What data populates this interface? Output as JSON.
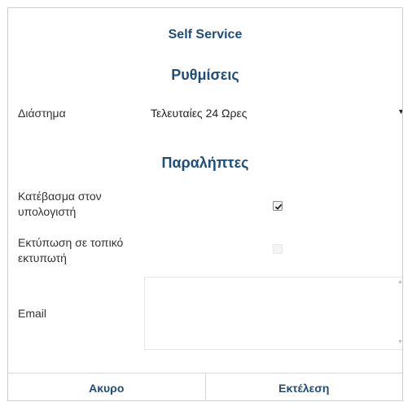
{
  "dialog": {
    "title": "Self Service",
    "settings": {
      "heading": "Ρυθμίσεις",
      "interval_label": "Διάστημα",
      "interval_value": "Τελευταίες 24 Ωρες"
    },
    "recipients": {
      "heading": "Παραλήπτες",
      "download_label": "Κατέβασμα στον υπολογιστή",
      "download_checked": true,
      "print_label": "Εκτύπωση σε τοπικό εκτυπωτή",
      "print_enabled": false,
      "email_label": "Email",
      "email_value": ""
    },
    "footer": {
      "cancel_label": "Ακυρο",
      "run_label": "Εκτέλεση"
    }
  },
  "colors": {
    "accent": "#1f4e79",
    "border": "#cfcfcf"
  },
  "icons": {
    "dropdown": "caret-down-icon",
    "checkbox": "check-icon"
  }
}
